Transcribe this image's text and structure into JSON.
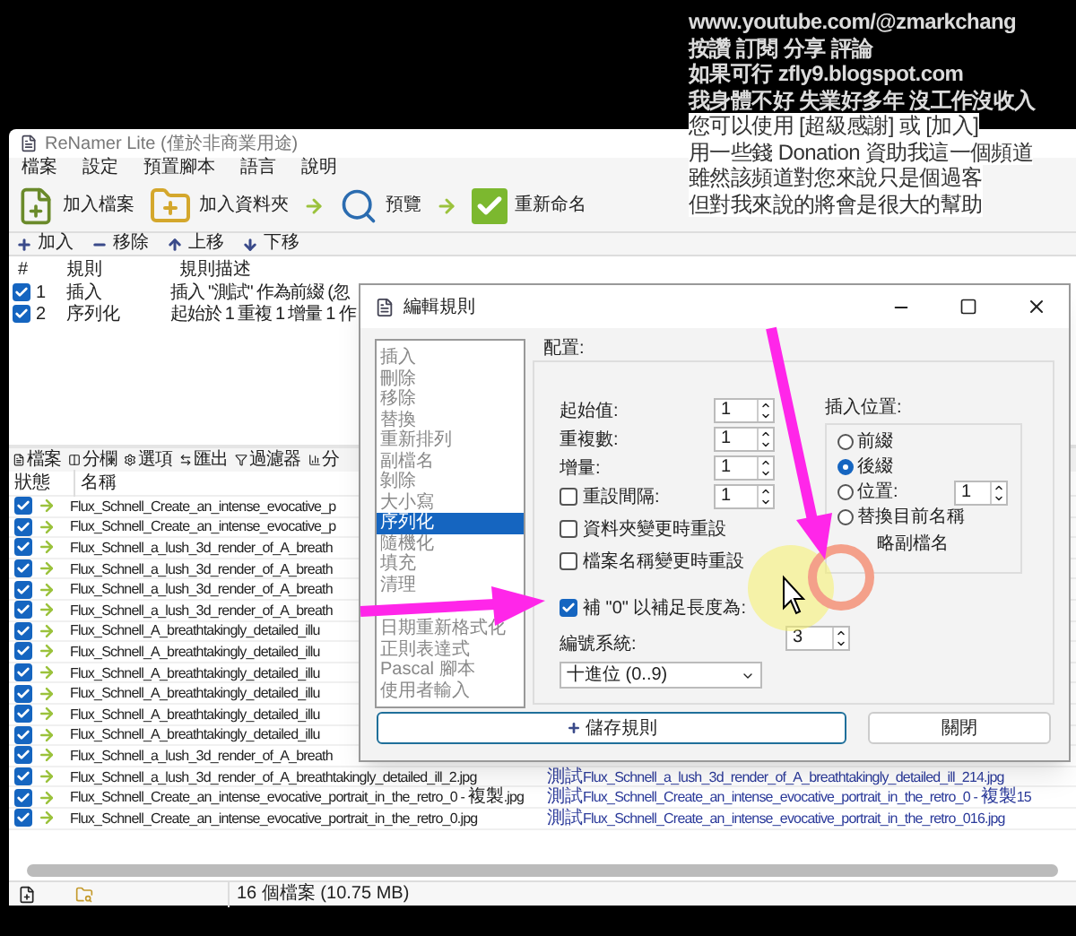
{
  "overlay": {
    "on_dark": [
      "www.youtube.com/@zmarkchang",
      "按讚 訂閱 分享 評論",
      "如果可行 zfly9.blogspot.com",
      "我身體不好 失業好多年 沒工作沒收入"
    ],
    "on_light": [
      "您可以使用 [超級感謝] 或 [加入]",
      "用一些錢 Donation 資助我這一個頻道",
      "雖然該頻道對您來說只是個過客",
      "但對我來說的將會是很大的幫助"
    ]
  },
  "window": {
    "title": "ReNamer Lite (僅於非商業用途)"
  },
  "menu": [
    "檔案",
    "設定",
    "預置腳本",
    "語言",
    "說明"
  ],
  "toolbar": [
    {
      "kind": "add-files",
      "label": "加入檔案"
    },
    {
      "kind": "add-folder",
      "label": "加入資料夾"
    },
    {
      "kind": "arrow"
    },
    {
      "kind": "preview",
      "label": "預覽"
    },
    {
      "kind": "arrow"
    },
    {
      "kind": "rename",
      "label": "重新命名"
    }
  ],
  "rules_toolbar": [
    {
      "kind": "add",
      "label": "加入"
    },
    {
      "kind": "remove",
      "label": "移除"
    },
    {
      "kind": "up",
      "label": "上移"
    },
    {
      "kind": "down",
      "label": "下移"
    }
  ],
  "rules_table": {
    "columns": [
      "#",
      "規則",
      "規則描述"
    ],
    "rows": [
      {
        "checked": true,
        "number": "1",
        "rule": "插入",
        "description": "插入 \"測試\" 作為前綴 (忽"
      },
      {
        "checked": true,
        "number": "2",
        "rule": "序列化",
        "description": "起始於 1 重複 1 增量 1 作"
      }
    ]
  },
  "files_toolbar": [
    {
      "kind": "files",
      "label": "檔案"
    },
    {
      "kind": "columns",
      "label": "分欄"
    },
    {
      "kind": "options",
      "label": "選項"
    },
    {
      "kind": "export",
      "label": "匯出"
    },
    {
      "kind": "filter",
      "label": "過濾器"
    },
    {
      "kind": "analyze",
      "label": "分"
    }
  ],
  "files_table": {
    "columns": [
      "狀態",
      "名稱"
    ],
    "rows": [
      {
        "checked": true,
        "name": "Flux_Schnell_Create_an_intense_evocative_p"
      },
      {
        "checked": true,
        "name": "Flux_Schnell_Create_an_intense_evocative_p"
      },
      {
        "checked": true,
        "name": "Flux_Schnell_a_lush_3d_render_of_A_breath"
      },
      {
        "checked": true,
        "name": "Flux_Schnell_a_lush_3d_render_of_A_breath"
      },
      {
        "checked": true,
        "name": "Flux_Schnell_a_lush_3d_render_of_A_breath"
      },
      {
        "checked": true,
        "name": "Flux_Schnell_a_lush_3d_render_of_A_breath"
      },
      {
        "checked": true,
        "name": "Flux_Schnell_A_breathtakingly_detailed_illu"
      },
      {
        "checked": true,
        "name": "Flux_Schnell_A_breathtakingly_detailed_illu"
      },
      {
        "checked": true,
        "name": "Flux_Schnell_A_breathtakingly_detailed_illu"
      },
      {
        "checked": true,
        "name": "Flux_Schnell_A_breathtakingly_detailed_illu"
      },
      {
        "checked": true,
        "name": "Flux_Schnell_A_breathtakingly_detailed_illu"
      },
      {
        "checked": true,
        "name": "Flux_Schnell_A_breathtakingly_detailed_illu"
      },
      {
        "checked": true,
        "name": "Flux_Schnell_a_lush_3d_render_of_A_breath"
      },
      {
        "checked": true,
        "name": "Flux_Schnell_a_lush_3d_render_of_A_breathtakingly_detailed_ill_2.jpg",
        "new_name": "測試Flux_Schnell_a_lush_3d_render_of_A_breathtakingly_detailed_ill_214.jpg"
      },
      {
        "checked": true,
        "name": "Flux_Schnell_Create_an_intense_evocative_portrait_in_the_retro_0 - 複製.jpg",
        "new_name": "測試Flux_Schnell_Create_an_intense_evocative_portrait_in_the_retro_0 - 複製15"
      },
      {
        "checked": true,
        "name": "Flux_Schnell_Create_an_intense_evocative_portrait_in_the_retro_0.jpg",
        "new_name": "測試Flux_Schnell_Create_an_intense_evocative_portrait_in_the_retro_016.jpg"
      }
    ]
  },
  "status_bar": {
    "text": "16 個檔案 (10.75 MB)"
  },
  "dialog": {
    "title": "編輯規則",
    "rule_list": [
      {
        "label": "插入",
        "selected": false
      },
      {
        "label": "刪除",
        "selected": false
      },
      {
        "label": "移除",
        "selected": false
      },
      {
        "label": "替換",
        "selected": false
      },
      {
        "label": "重新排列",
        "selected": false
      },
      {
        "label": "副檔名",
        "selected": false
      },
      {
        "label": "剝除",
        "selected": false
      },
      {
        "label": "大小寫",
        "selected": false
      },
      {
        "label": "序列化",
        "selected": true
      },
      {
        "label": "隨機化",
        "selected": false
      },
      {
        "label": "填充",
        "selected": false
      },
      {
        "label": "清理",
        "selected": false
      },
      {
        "label": "日期重新格式化",
        "selected": false
      },
      {
        "label": "正則表達式",
        "selected": false
      },
      {
        "label": "Pascal 腳本",
        "selected": false
      },
      {
        "label": "使用者輸入",
        "selected": false
      }
    ],
    "config_label": "配置:",
    "fields": [
      {
        "kind": "spin",
        "label": "起始值:",
        "value": "1"
      },
      {
        "kind": "spin",
        "label": "重複數:",
        "value": "1"
      },
      {
        "kind": "spin",
        "label": "增量:",
        "value": "1"
      },
      {
        "kind": "check-spin",
        "label": "重設間隔:",
        "value": "1",
        "checked": false
      }
    ],
    "checkboxes": [
      {
        "label": "資料夾變更時重設",
        "checked": false
      },
      {
        "label": "檔案名稱變更時重設",
        "checked": false
      }
    ],
    "padding": {
      "label": "補 \"0\" 以補足長度為:",
      "checked": true,
      "value": "3"
    },
    "numbering": {
      "label": "編號系統:",
      "value": "十進位 (0..9)"
    },
    "insert_position": {
      "label": "插入位置:",
      "options": [
        {
          "label": "前綴",
          "selected": false
        },
        {
          "label": "後綴",
          "selected": true
        },
        {
          "label": "位置:",
          "selected": false,
          "value": "1"
        },
        {
          "label": "替換目前名稱",
          "selected": false
        }
      ],
      "extension_label": "略副檔名"
    },
    "buttons": [
      {
        "kind": "save",
        "label": "儲存規則"
      },
      {
        "kind": "close",
        "label": "關閉"
      }
    ]
  }
}
